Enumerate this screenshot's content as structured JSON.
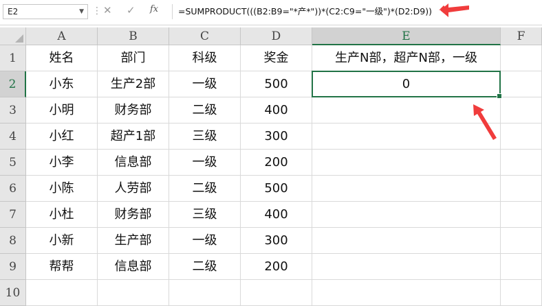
{
  "formula_bar": {
    "name_box": "E2",
    "cancel_icon": "✕",
    "confirm_icon": "✓",
    "fx_label": "fx",
    "formula": "=SUMPRODUCT(((B2:B9=\"*产*\"))*(C2:C9=\"一级\")*(D2:D9))"
  },
  "columns": [
    "A",
    "B",
    "C",
    "D",
    "E",
    "F"
  ],
  "rows": [
    "1",
    "2",
    "3",
    "4",
    "5",
    "6",
    "7",
    "8",
    "9",
    "10"
  ],
  "cells": {
    "A1": "姓名",
    "B1": "部门",
    "C1": "科级",
    "D1": "奖金",
    "E1": "生产N部，超产N部，一级",
    "A2": "小东",
    "B2": "生产2部",
    "C2": "一级",
    "D2": "500",
    "E2": "0",
    "A3": "小明",
    "B3": "财务部",
    "C3": "二级",
    "D3": "400",
    "A4": "小红",
    "B4": "超产1部",
    "C4": "三级",
    "D4": "300",
    "A5": "小李",
    "B5": "信息部",
    "C5": "一级",
    "D5": "200",
    "A6": "小陈",
    "B6": "人劳部",
    "C6": "二级",
    "D6": "500",
    "A7": "小杜",
    "B7": "财务部",
    "C7": "三级",
    "D7": "400",
    "A8": "小新",
    "B8": "生产部",
    "C8": "一级",
    "D8": "300",
    "A9": "帮帮",
    "B9": "信息部",
    "C9": "二级",
    "D9": "200"
  },
  "active_cell": "E2",
  "colors": {
    "accent": "#217346",
    "arrow": "#f03c3c"
  }
}
